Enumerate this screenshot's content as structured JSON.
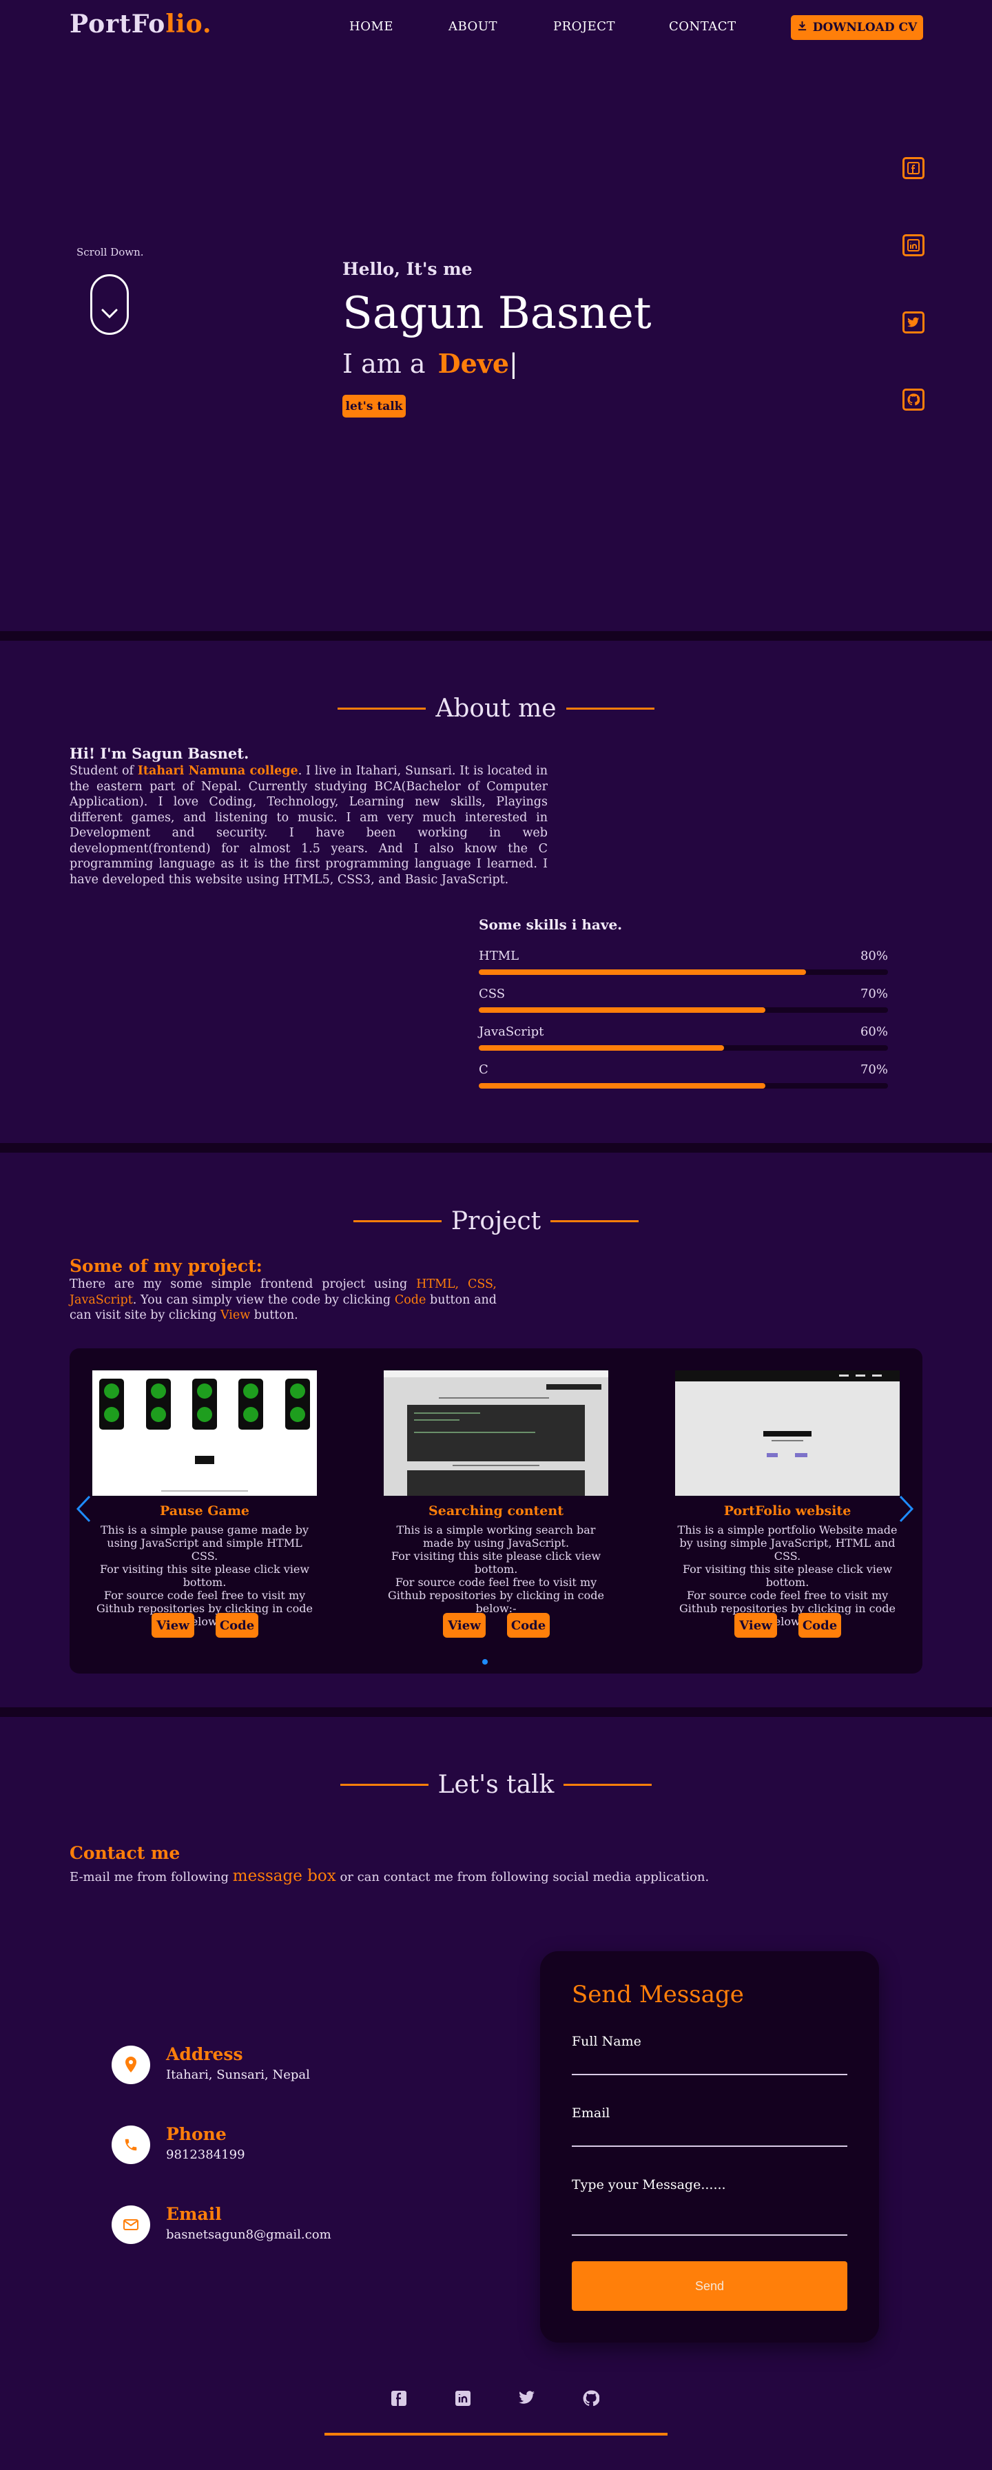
{
  "nav": {
    "logo_prefix": "PortFo",
    "logo_suffix": "lio",
    "logo_dot": ".",
    "links": [
      "HOME",
      "ABOUT",
      "PROJECT",
      "CONTACT"
    ],
    "download_label": "DOWNLOAD CV",
    "download_icon": "download-icon"
  },
  "hero": {
    "scroll_text": "Scroll Down.",
    "greeting": "Hello, It's me",
    "name": "Sagun Basnet",
    "role_prefix": "I am a",
    "role_typed": "Deve",
    "role_caret": "|",
    "talk_button": "let's talk",
    "social_icons": [
      "facebook-icon",
      "linkedin-icon",
      "twitter-icon",
      "github-icon"
    ]
  },
  "about": {
    "heading": "About me",
    "hi": "Hi! I'm Sagun Basnet.",
    "text_before": "Student of ",
    "college": "Itahari Namuna college",
    "text_after": ". I live in Itahari, Sunsari. It is located in the eastern part of Nepal. Currently studying BCA(Bachelor of Computer Application). I love Coding, Technology, Learning new skills, Playings different games, and listening to music. I am very much interested in Development and security. I have been working in web development(frontend) for almost 1.5 years. And I also know the C programming language as it is the first programming language I learned. I have developed this website using HTML5, CSS3, and Basic JavaScript.",
    "skills_title": "Some skills i have.",
    "skills": [
      {
        "name": "HTML",
        "label": "80%",
        "value": 80
      },
      {
        "name": "CSS",
        "label": "70%",
        "value": 70
      },
      {
        "name": "JavaScript",
        "label": "60%",
        "value": 60
      },
      {
        "name": "C",
        "label": "70%",
        "value": 70
      }
    ]
  },
  "project": {
    "heading": "Project",
    "title": "Some of my project:",
    "intro_1": "There are my some simple frontend project using ",
    "tech": "HTML, CSS, JavaScript",
    "intro_2": ". You can simply view the code by clicking ",
    "code_word": "Code",
    "intro_3": " button and can visit site by clicking ",
    "view_word": "View",
    "intro_4": " button.",
    "cards": [
      {
        "title": "Pause Game",
        "desc": "This is a simple pause game made by using JavaScript and simple HTML CSS.\nFor visiting this site please click view bottom.\nFor source code feel free to visit my Github repositories by clicking in code below:-",
        "view": "View",
        "code": "Code",
        "thumb_caption": "Created by Sagun Basnet"
      },
      {
        "title": "Searching content",
        "desc": "This is a simple working search bar made by using JavaScript.\nFor visiting this site please click view bottom.\nFor source code feel free to visit my Github repositories by clicking in code below:-",
        "view": "View",
        "code": "Code"
      },
      {
        "title": "PortFolio website",
        "desc": "This is a simple portfolio Website made by using simple JavaScript, HTML and CSS.\nFor visiting this site please click view bottom.\nFor source code feel free to visit my Github repositories by clicking in code below:-",
        "view": "View",
        "code": "Code",
        "thumb_name": "Sagun Basnet",
        "thumb_logo": "PortFolio"
      }
    ]
  },
  "contact": {
    "heading": "Let's talk",
    "title": "Contact me",
    "text_1": "E-mail me from following ",
    "message_box": "message box",
    "text_2": " or can contact me from following social media application.",
    "items": [
      {
        "label": "Address",
        "value": "Itahari, Sunsari, Nepal",
        "icon": "location-pin-icon"
      },
      {
        "label": "Phone",
        "value": "9812384199",
        "icon": "phone-icon"
      },
      {
        "label": "Email",
        "value": "basnetsagun8@gmail.com",
        "icon": "envelope-icon"
      }
    ],
    "form": {
      "title": "Send Message",
      "full_name": "Full Name",
      "email": "Email",
      "message": "Type your Message......",
      "send": "Send"
    }
  },
  "footer": {
    "social_icons": [
      "facebook-icon",
      "linkedin-icon",
      "twitter-icon",
      "github-icon"
    ]
  },
  "colors": {
    "background": "#240640",
    "dark_panel": "#14011f",
    "accent": "#ff7f0a",
    "carousel_dot": "#1e8cff"
  }
}
